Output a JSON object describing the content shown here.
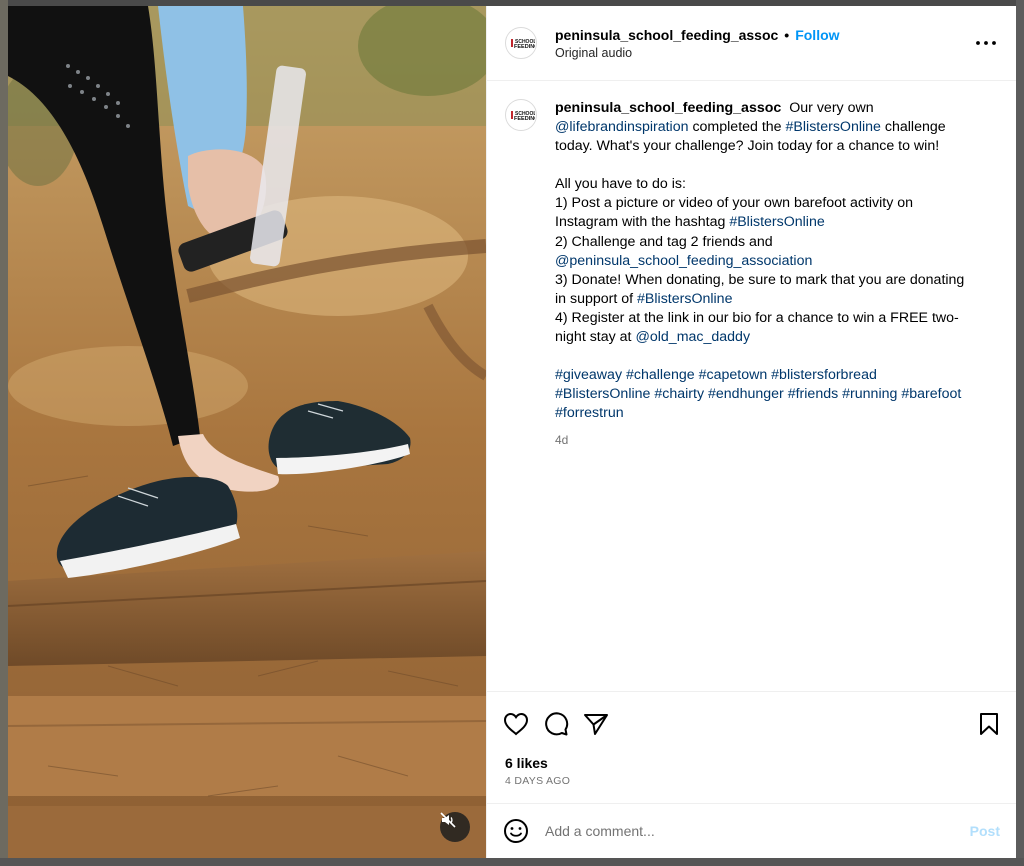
{
  "post": {
    "username": "peninsula_school_feeding_assoc",
    "follow_label": "Follow",
    "audio_label": "Original audio",
    "avatar_logo_text": "SCHOOL FEEDING"
  },
  "caption": {
    "username": "peninsula_school_feeding_assoc",
    "p1_a": "Our very own",
    "p1_mention": "@lifebrandinspiration",
    "p1_b": "completed the",
    "p1_tag": "#BlistersOnline",
    "p1_c": "challenge today. What's your challenge? Join today for a chance to win!",
    "p2_intro": "All you have to do is:",
    "step1_a": "1) Post a picture or video of your own barefoot activity on Instagram with the hashtag",
    "step1_tag": "#BlistersOnline",
    "step2_a": "2) Challenge and tag 2 friends and",
    "step2_mention": "@peninsula_school_feeding_association",
    "step3_a": "3) Donate! When donating, be sure to mark that you are donating in support of",
    "step3_tag": "#BlistersOnline",
    "step4_a": "4) Register at the link in our bio for a chance to win a FREE two-night stay at",
    "step4_mention": "@old_mac_daddy",
    "hashtags": [
      "#giveaway",
      "#challenge",
      "#capetown",
      "#blistersforbread",
      "#BlistersOnline",
      "#chairty",
      "#endhunger",
      "#friends",
      "#running",
      "#barefoot",
      "#forrestrun"
    ],
    "time_ago": "4d"
  },
  "stats": {
    "likes": "6 likes",
    "date": "4 DAYS AGO"
  },
  "comment": {
    "placeholder": "Add a comment...",
    "post_label": "Post"
  },
  "icons": {
    "like": "heart-icon",
    "comment": "comment-icon",
    "share": "share-icon",
    "save": "bookmark-icon",
    "more": "more-icon",
    "emoji": "emoji-icon",
    "mute": "muted-speaker-icon"
  },
  "colors": {
    "link": "#00376b",
    "follow": "#0095f6",
    "post_disabled": "#b2dffc"
  }
}
